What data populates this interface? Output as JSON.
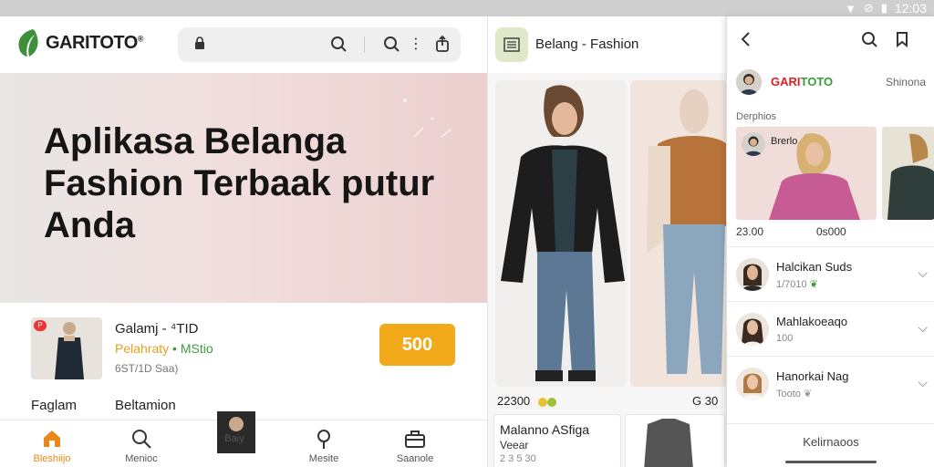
{
  "status_bar": {
    "time": "12:03",
    "icons": [
      "heart-icon",
      "wifi-icon",
      "signal-icon",
      "wifi-icon",
      "mute-icon",
      "battery-icon"
    ]
  },
  "left_app": {
    "brand": "GARITOTO",
    "brand_mark": "®",
    "hero_title": "Aplikasa Belanga Fashion Terbaak putur Anda",
    "product": {
      "title": "Galamj - ⁴TID",
      "subtitle_a": "Pelahraty",
      "subtitle_b": "• MStio",
      "meta": "6ST/1D Saa)",
      "price_button": "500",
      "badge": "P"
    },
    "row2": {
      "left": "Faglam",
      "right": "Beltamion"
    },
    "bottom_nav": [
      {
        "label": "Bleshiijo",
        "icon": "home-icon"
      },
      {
        "label": "Menioc",
        "icon": "search-icon"
      },
      {
        "label": "Baiy",
        "icon": "cart-icon"
      },
      {
        "label": "Mesite",
        "icon": "location-icon"
      },
      {
        "label": "Saanole",
        "icon": "bag-icon"
      }
    ]
  },
  "mid_app": {
    "title": "Belang - Fashion",
    "price_left": "22300",
    "price_right": "G 30",
    "mini_card": {
      "title": "Malanno ASfiga",
      "subtitle": "Veear",
      "price": "2 3 5 30"
    }
  },
  "right_app": {
    "brand_a": "GARI",
    "brand_b": "TOTO",
    "brand_right": "Shinona",
    "section_label": "Derphios",
    "card_name": "Brerlo",
    "price_a": "23.00",
    "price_b": "0s000",
    "list": [
      {
        "name": "Halcikan Suds",
        "sub": "1/7010"
      },
      {
        "name": "Mahlakoeaqo",
        "sub": "100"
      },
      {
        "name": "Hanorkai Nag",
        "sub": "Tooto"
      }
    ],
    "footer": "Kelirnaoos"
  }
}
